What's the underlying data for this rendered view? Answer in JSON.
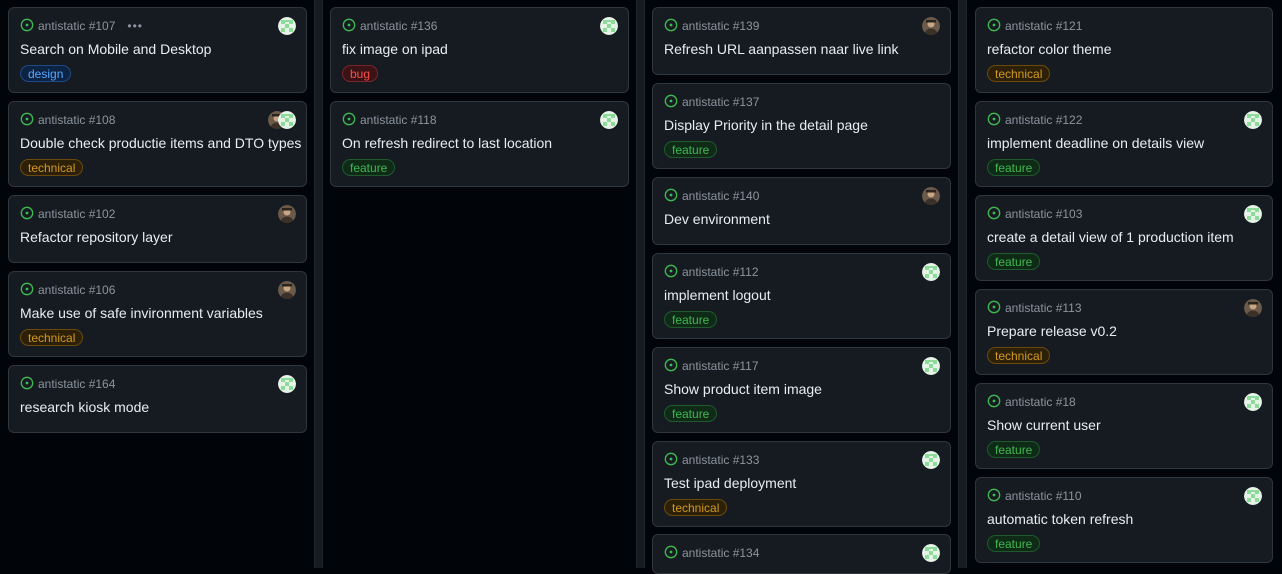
{
  "columns": [
    {
      "cards": [
        {
          "meta": "antistatic #107",
          "title": "Search on Mobile and Desktop",
          "label": "design",
          "avatar": "identicon",
          "more": "•••"
        },
        {
          "meta": "antistatic #108",
          "title": "Double check productie items and DTO types",
          "label": "technical",
          "avatar": "identicon+photo"
        },
        {
          "meta": "antistatic #102",
          "title": "Refactor repository layer",
          "label": "",
          "avatar": "photo"
        },
        {
          "meta": "antistatic #106",
          "title": "Make use of safe invironment variables",
          "label": "technical",
          "avatar": "photo"
        },
        {
          "meta": "antistatic #164",
          "title": "research kiosk mode",
          "label": "",
          "avatar": "identicon"
        }
      ]
    },
    {
      "cards": [
        {
          "meta": "antistatic #136",
          "title": "fix image on ipad",
          "label": "bug",
          "avatar": "identicon"
        },
        {
          "meta": "antistatic #118",
          "title": "On refresh redirect to last location",
          "label": "feature",
          "avatar": "identicon"
        }
      ]
    },
    {
      "cards": [
        {
          "meta": "antistatic #139",
          "title": "Refresh URL aanpassen naar live link",
          "label": "",
          "avatar": "photo"
        },
        {
          "meta": "antistatic #137",
          "title": "Display Priority in the detail page",
          "label": "feature",
          "avatar": ""
        },
        {
          "meta": "antistatic #140",
          "title": "Dev environment",
          "label": "",
          "avatar": "photo"
        },
        {
          "meta": "antistatic #112",
          "title": "implement logout",
          "label": "feature",
          "avatar": "identicon"
        },
        {
          "meta": "antistatic #117",
          "title": "Show product item image",
          "label": "feature",
          "avatar": "identicon"
        },
        {
          "meta": "antistatic #133",
          "title": "Test ipad deployment",
          "label": "technical",
          "avatar": "identicon"
        },
        {
          "meta": "antistatic #134",
          "title": "",
          "label": "",
          "avatar": "identicon"
        }
      ]
    },
    {
      "cards": [
        {
          "meta": "antistatic #121",
          "title": "refactor color theme",
          "label": "technical",
          "avatar": ""
        },
        {
          "meta": "antistatic #122",
          "title": "implement deadline on details view",
          "label": "feature",
          "avatar": "identicon"
        },
        {
          "meta": "antistatic #103",
          "title": "create a detail view of 1 production item",
          "label": "feature",
          "avatar": "identicon"
        },
        {
          "meta": "antistatic #113",
          "title": "Prepare release v0.2",
          "label": "technical",
          "avatar": "photo"
        },
        {
          "meta": "antistatic #18",
          "title": "Show current user",
          "label": "feature",
          "avatar": "identicon"
        },
        {
          "meta": "antistatic #110",
          "title": "automatic token refresh",
          "label": "feature",
          "avatar": "identicon"
        }
      ]
    }
  ],
  "colors": {
    "open_status": "#3fb950",
    "identicon": "#8ddb9a",
    "identicon_bg": "#e6f4e8"
  }
}
